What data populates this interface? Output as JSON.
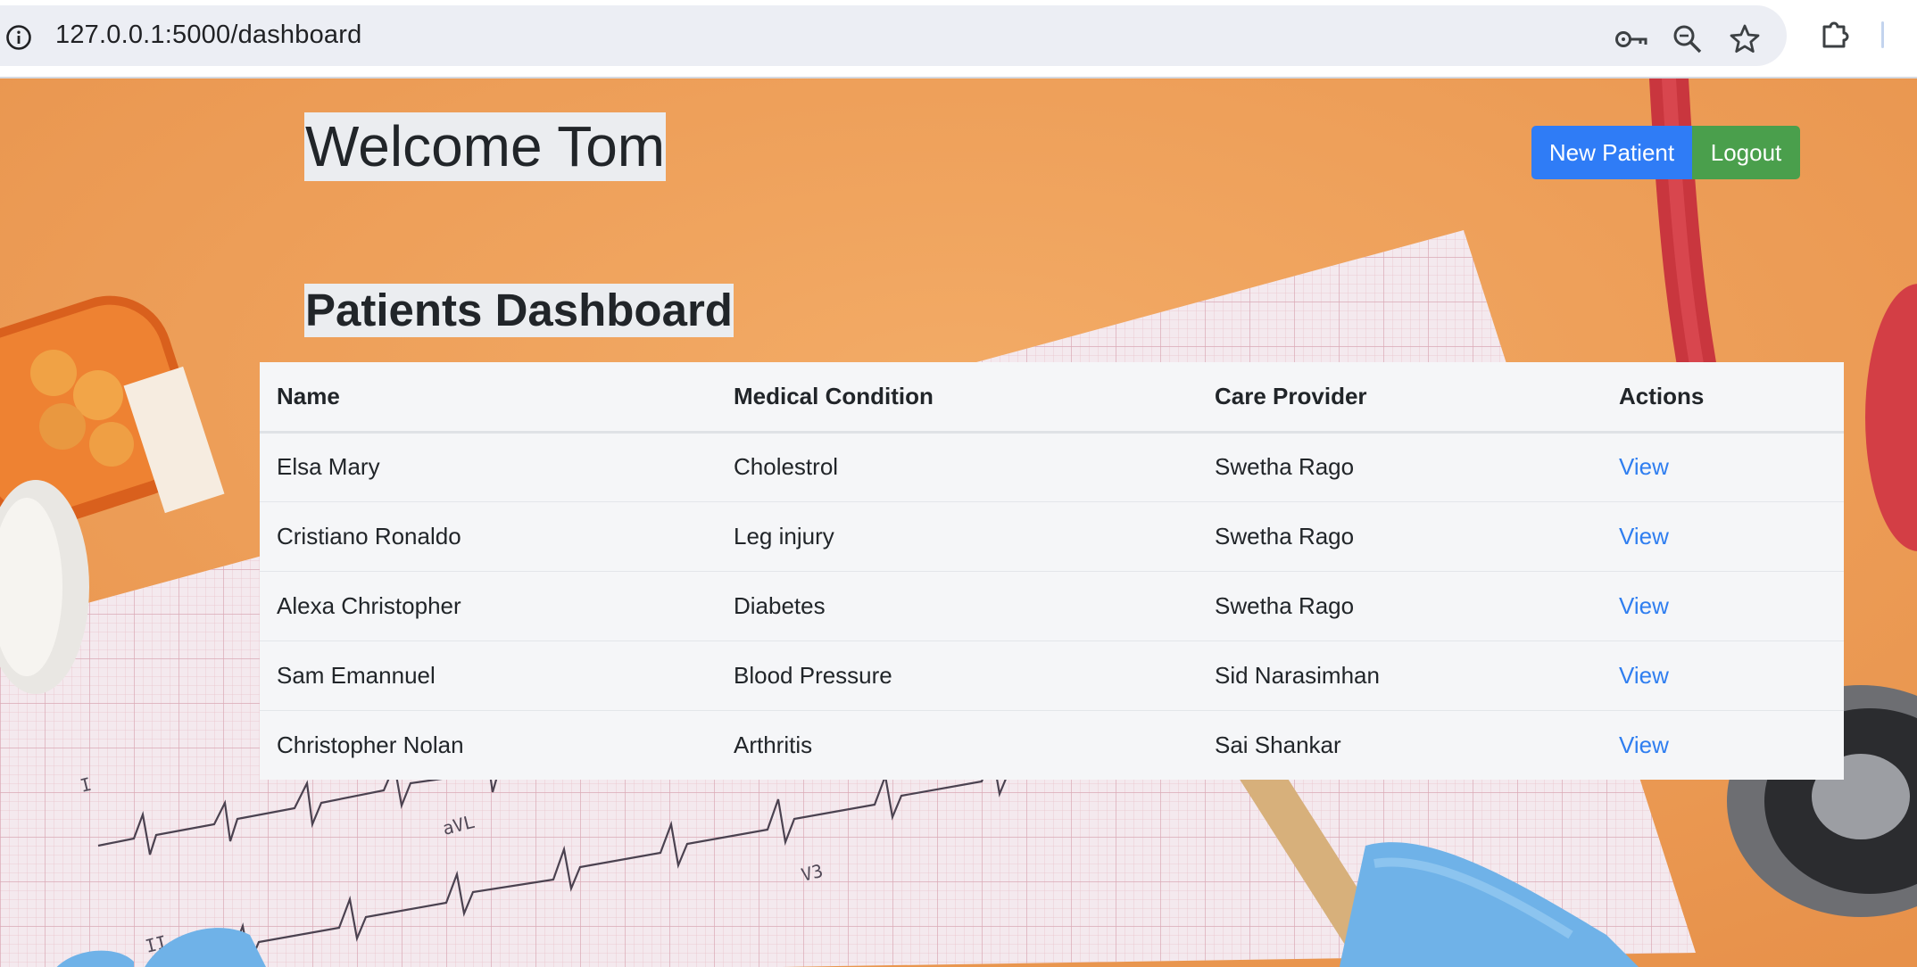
{
  "browser": {
    "url": "127.0.0.1:5000/dashboard",
    "icons": [
      "info-icon",
      "key-icon",
      "zoom-icon",
      "bookmark-star-icon",
      "extensions-puzzle-icon"
    ]
  },
  "header": {
    "welcome": "Welcome Tom",
    "new_patient_label": "New Patient",
    "logout_label": "Logout"
  },
  "dashboard": {
    "title": "Patients Dashboard",
    "columns": [
      "Name",
      "Medical Condition",
      "Care Provider",
      "Actions"
    ],
    "rows": [
      {
        "name": "Elsa Mary",
        "condition": "Cholestrol",
        "provider": "Swetha Rago",
        "action": "View"
      },
      {
        "name": "Cristiano Ronaldo",
        "condition": "Leg injury",
        "provider": "Swetha Rago",
        "action": "View"
      },
      {
        "name": "Alexa Christopher",
        "condition": "Diabetes",
        "provider": "Swetha Rago",
        "action": "View"
      },
      {
        "name": "Sam Emannuel",
        "condition": "Blood Pressure",
        "provider": "Sid Narasimhan",
        "action": "View"
      },
      {
        "name": "Christopher Nolan",
        "condition": "Arthritis",
        "provider": "Sai Shankar",
        "action": "View"
      }
    ]
  },
  "background": {
    "ecg_labels": [
      "I",
      "aVL",
      "V3",
      "II"
    ]
  },
  "colors": {
    "background_orange": "#ef9f55",
    "primary_button": "#2f7cf6",
    "success_button": "#4a9f4c",
    "link": "#2f7ef0",
    "table_bg": "#f5f6f8"
  }
}
